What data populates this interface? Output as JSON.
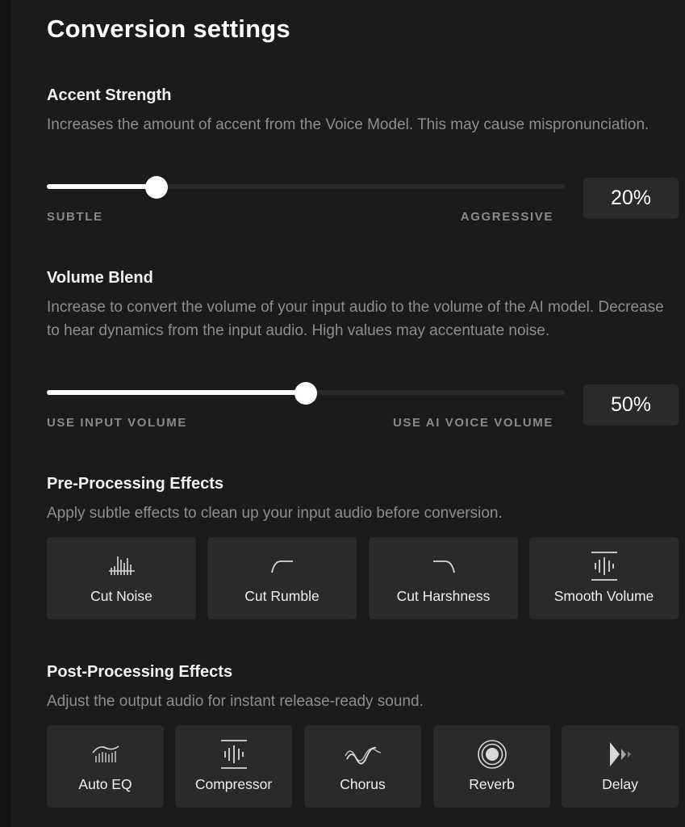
{
  "title": "Conversion settings",
  "accent_strength": {
    "heading": "Accent Strength",
    "description": "Increases the amount of accent from the Voice Model. This may cause mispronunciation.",
    "value": 20,
    "value_label": "20%",
    "min_label": "SUBTLE",
    "max_label": "AGGRESSIVE"
  },
  "volume_blend": {
    "heading": "Volume Blend",
    "description": "Increase to convert the volume of your input audio to the volume of the AI model. Decrease to hear dynamics from the input audio. High values may accentuate noise.",
    "value": 50,
    "value_label": "50%",
    "min_label": "USE INPUT VOLUME",
    "max_label": "USE AI VOICE VOLUME"
  },
  "pre_processing": {
    "heading": "Pre-Processing Effects",
    "description": "Apply subtle effects to clean up your input audio before conversion.",
    "effects": [
      {
        "label": "Cut Noise",
        "icon": "noise-gate-icon"
      },
      {
        "label": "Cut Rumble",
        "icon": "high-pass-curve-icon"
      },
      {
        "label": "Cut Harshness",
        "icon": "low-pass-curve-icon"
      },
      {
        "label": "Smooth Volume",
        "icon": "compressor-bars-icon"
      }
    ]
  },
  "post_processing": {
    "heading": "Post-Processing Effects",
    "description": "Adjust the output audio for instant release-ready sound.",
    "effects": [
      {
        "label": "Auto EQ",
        "icon": "eq-bars-icon"
      },
      {
        "label": "Compressor",
        "icon": "compressor-bars-icon"
      },
      {
        "label": "Chorus",
        "icon": "wave-icon"
      },
      {
        "label": "Reverb",
        "icon": "concentric-circles-icon"
      },
      {
        "label": "Delay",
        "icon": "echo-triangles-icon"
      }
    ]
  },
  "colors": {
    "background": "#1b1b1b",
    "card": "#2a2a2a",
    "muted_text": "#8e8e8e",
    "accent": "#ffffff"
  }
}
